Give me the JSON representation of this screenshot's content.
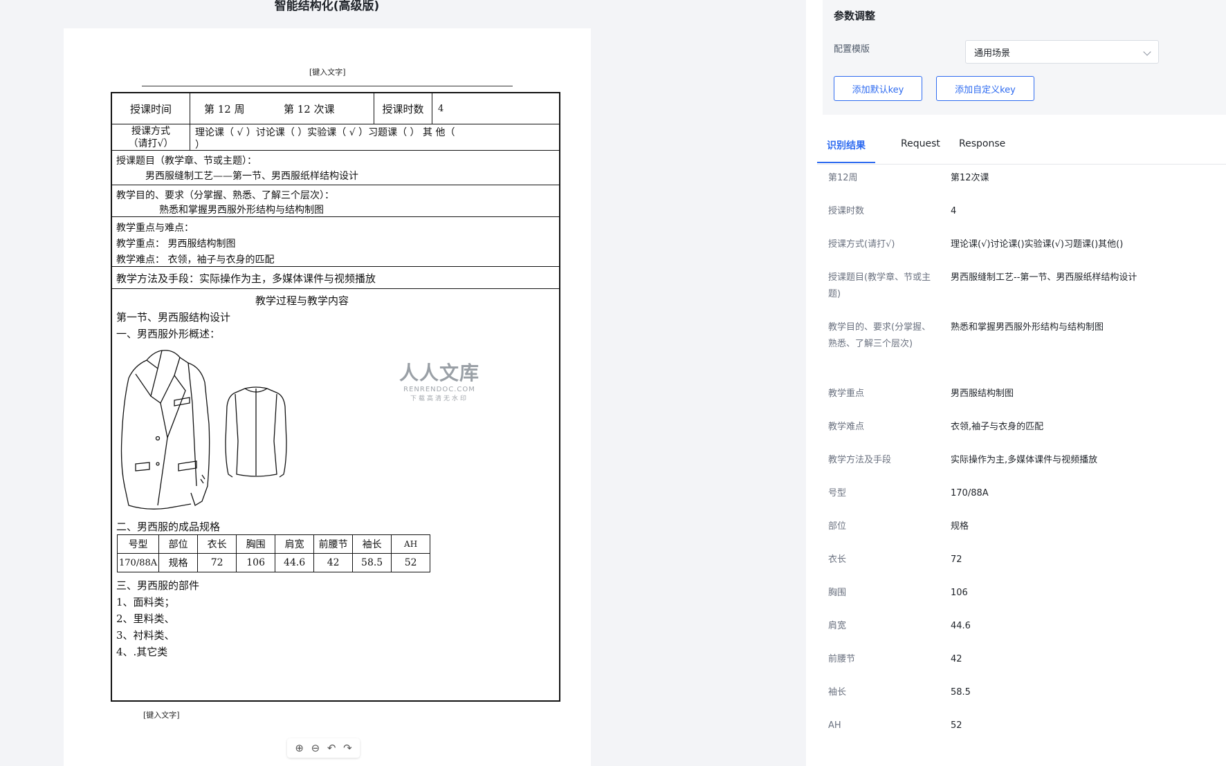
{
  "page_title": "智能结构化(高级版)",
  "document": {
    "header_note": "[键入文字]",
    "footer_note": "[键入文字]",
    "row1": {
      "label": "授课时间",
      "week": "第 12 周",
      "lesson": "第  12 次课",
      "hours_label": "授课时数",
      "hours_value": "4"
    },
    "row2": {
      "label_line1": "授课方式",
      "label_line2": "（请打√）",
      "content": "理论课（  √  ）讨论课（    ）实验课（  √  ）习题课（      ）  其    他（",
      "content_wrap": "）"
    },
    "topic": {
      "label": "授课题目（教学章、节或主题）：",
      "value": "男西服缝制工艺——第一节、男西服纸样结构设计"
    },
    "goal": {
      "label": "教学目的、要求（分掌握、熟悉、了解三个层次）：",
      "value": "熟悉和掌握男西服外形结构与结构制图"
    },
    "key_points": {
      "label": "教学重点与难点：",
      "focus": "教学重点：  男西服结构制图",
      "difficulty": "教学难点：  衣领，袖子与衣身的匹配"
    },
    "method": "教学方法及手段：实际操作为主，多媒体课件与视频播放",
    "process": {
      "heading": "教学过程与教学内容",
      "section": "第一节、男西服结构设计",
      "sub1": "一、男西服外形概述：",
      "sub2": "二、男西服的成品规格",
      "sub3": "三、男西服的部件",
      "items": [
        "1、面料类；",
        "2、里料类、",
        "3、衬料类、",
        "4、.其它类"
      ]
    },
    "spec_table": {
      "headers": [
        "号型",
        "部位",
        "衣长",
        "胸围",
        "肩宽",
        "前腰节",
        "袖长",
        "AH"
      ],
      "row": [
        "170/88A",
        "规格",
        "72",
        "106",
        "44.6",
        "42",
        "58.5",
        "52"
      ]
    },
    "watermark": {
      "line1": "人人文库",
      "line2": "RENRENDOC.COM",
      "line3": "下载高清无水印"
    }
  },
  "zoom_controls": {
    "zoom_in": "⊕",
    "zoom_out": "⊖",
    "rotate_left": "↶",
    "rotate_right": "↷"
  },
  "params": {
    "title": "参数调整",
    "template_label": "配置模版",
    "template_value": "通用场景",
    "add_default_key": "添加默认key",
    "add_custom_key": "添加自定义key"
  },
  "tabs": {
    "result": "识别结果",
    "request": "Request",
    "response": "Response"
  },
  "results": [
    {
      "key": "第12周",
      "value": "第12次课"
    },
    {
      "key": "授课时数",
      "value": "4"
    },
    {
      "key": "授课方式(请打√)",
      "value": "理论课(√)讨论课()实验课(√)习题课()其他()"
    },
    {
      "key": "授课题目(教学章、节或主题)",
      "value": "男西服缝制工艺--第一节、男西服纸样结构设计"
    },
    {
      "key": "教学目的、要求(分掌握、熟悉、了解三个层次)",
      "value": "熟悉和掌握男西服外形结构与结构制图"
    },
    {
      "key": "教学重点",
      "value": "男西服结构制图"
    },
    {
      "key": "教学难点",
      "value": "衣领,袖子与衣身的匹配"
    },
    {
      "key": "教学方法及手段",
      "value": "实际操作为主,多媒体课件与视频播放"
    },
    {
      "key": "号型",
      "value": "170/88A"
    },
    {
      "key": "部位",
      "value": "规格"
    },
    {
      "key": "衣长",
      "value": "72"
    },
    {
      "key": "胸围",
      "value": "106"
    },
    {
      "key": "肩宽",
      "value": "44.6"
    },
    {
      "key": "前腰节",
      "value": "42"
    },
    {
      "key": "袖长",
      "value": "58.5"
    },
    {
      "key": "AH",
      "value": "52"
    }
  ],
  "colors": {
    "accent": "#2e6bf0",
    "panel_bg": "#f5f6f8",
    "canvas_bg": "#f3f4f7"
  }
}
